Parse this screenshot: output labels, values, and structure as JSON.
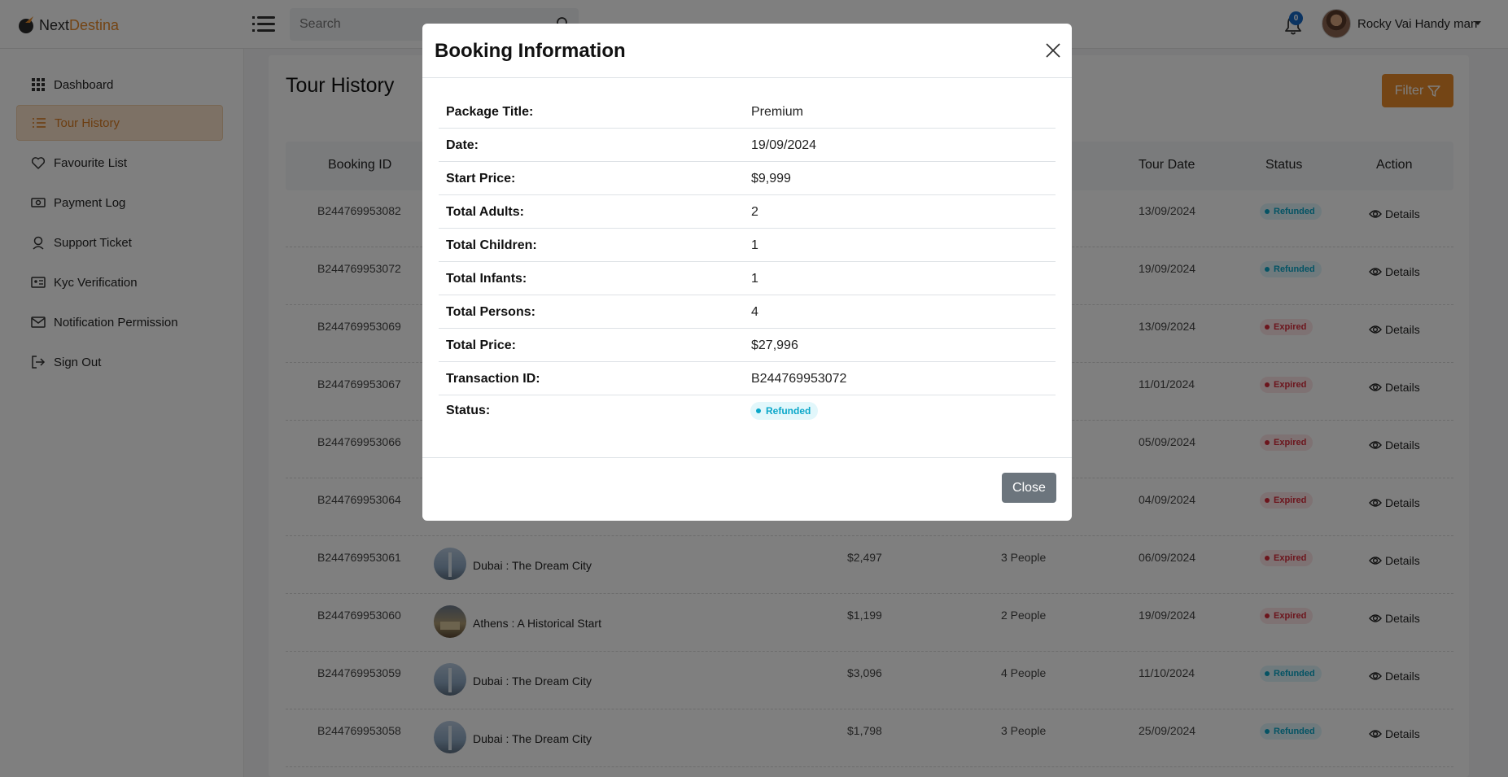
{
  "header": {
    "brand_first": "Next",
    "brand_second": "Destina",
    "search_placeholder": "Search",
    "notification_count": "0",
    "user_name": "Rocky Vai Handy man"
  },
  "sidebar": {
    "items": [
      {
        "label": "Dashboard",
        "icon": "grid-icon"
      },
      {
        "label": "Tour History",
        "icon": "list-icon",
        "active": true
      },
      {
        "label": "Favourite List",
        "icon": "heart-icon"
      },
      {
        "label": "Payment Log",
        "icon": "money-icon"
      },
      {
        "label": "Support Ticket",
        "icon": "support-icon"
      },
      {
        "label": "Kyc Verification",
        "icon": "id-card-icon"
      },
      {
        "label": "Notification Permission",
        "icon": "envelope-icon"
      },
      {
        "label": "Sign Out",
        "icon": "sign-out-icon"
      }
    ]
  },
  "page": {
    "title": "Tour History",
    "filter_label": "Filter"
  },
  "table": {
    "columns": {
      "booking_id": "Booking ID",
      "tour_date": "Tour Date",
      "status": "Status",
      "action": "Action"
    },
    "action_label": "Details",
    "rows": [
      {
        "booking_id": "B244769953082",
        "package": "",
        "price": "",
        "persons": "",
        "tour_date": "13/09/2024",
        "status": "Refunded"
      },
      {
        "booking_id": "B244769953072",
        "package": "",
        "price": "",
        "persons": "",
        "tour_date": "19/09/2024",
        "status": "Refunded"
      },
      {
        "booking_id": "B244769953069",
        "package": "",
        "price": "",
        "persons": "",
        "tour_date": "13/09/2024",
        "status": "Expired"
      },
      {
        "booking_id": "B244769953067",
        "package": "",
        "price": "",
        "persons": "",
        "tour_date": "11/01/2024",
        "status": "Expired"
      },
      {
        "booking_id": "B244769953066",
        "package": "",
        "price": "",
        "persons": "",
        "tour_date": "05/09/2024",
        "status": "Expired"
      },
      {
        "booking_id": "B244769953064",
        "package": "",
        "price": "",
        "persons": "",
        "tour_date": "04/09/2024",
        "status": "Expired"
      },
      {
        "booking_id": "B244769953061",
        "package": "Dubai : The Dream City",
        "price": "$2,497",
        "persons": "3 People",
        "tour_date": "06/09/2024",
        "status": "Expired"
      },
      {
        "booking_id": "B244769953060",
        "package": "Athens : A Historical Start",
        "price": "$1,199",
        "persons": "2 People",
        "tour_date": "19/09/2024",
        "status": "Expired"
      },
      {
        "booking_id": "B244769953059",
        "package": "Dubai : The Dream City",
        "price": "$3,096",
        "persons": "4 People",
        "tour_date": "11/10/2024",
        "status": "Refunded"
      },
      {
        "booking_id": "B244769953058",
        "package": "Dubai : The Dream City",
        "price": "$1,798",
        "persons": "3 People",
        "tour_date": "25/09/2024",
        "status": "Refunded"
      }
    ]
  },
  "modal": {
    "title": "Booking Information",
    "rows": [
      {
        "label": "Package Title:",
        "value": "Premium"
      },
      {
        "label": "Date:",
        "value": "19/09/2024"
      },
      {
        "label": "Start Price:",
        "value": "$9,999"
      },
      {
        "label": "Total Adults:",
        "value": "2"
      },
      {
        "label": "Total Children:",
        "value": "1"
      },
      {
        "label": "Total Infants:",
        "value": "1"
      },
      {
        "label": "Total Persons:",
        "value": "4"
      },
      {
        "label": "Total Price:",
        "value": "$27,996"
      },
      {
        "label": "Transaction ID:",
        "value": "B244769953072"
      }
    ],
    "status_label": "Status:",
    "status_value": "Refunded",
    "close_label": "Close"
  },
  "colors": {
    "accent": "#e88a2a",
    "refunded": "#0aa7c9",
    "expired": "#d92b3a",
    "badge_blue": "#1668c5"
  }
}
